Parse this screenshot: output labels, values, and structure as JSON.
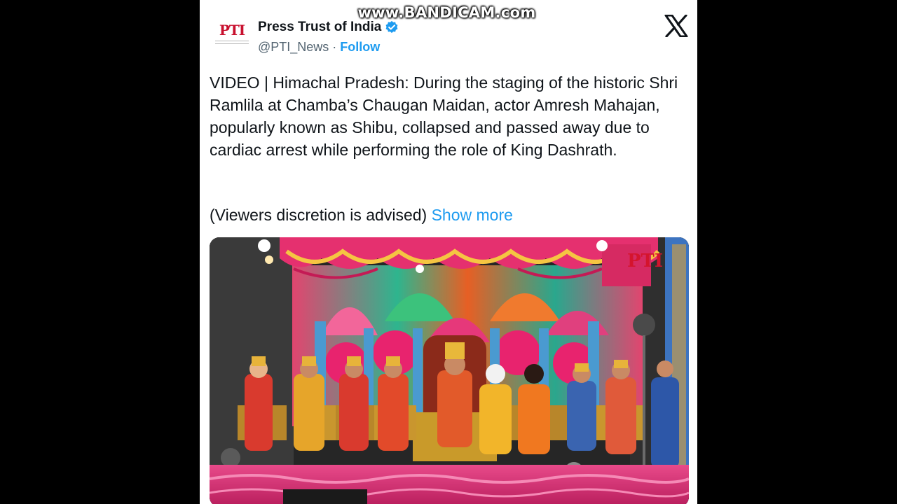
{
  "watermark": "www.BANDICAM.com",
  "tweet": {
    "author": {
      "display_name": "Press Trust of India",
      "handle": "@PTI_News",
      "follow_label": "Follow",
      "logo_text": "PTI",
      "verified": true
    },
    "text": "VIDEO | Himachal Pradesh: During the staging of the historic Shri Ramlila at Chamba’s Chaugan Maidan, actor Amresh Mahajan, popularly known as Shibu, collapsed and passed away due to cardiac arrest while performing the role of King Dashrath.",
    "advisory": "(Viewers discretion is advised)",
    "show_more_label": "Show more",
    "media_watermark": "PTI"
  },
  "icons": {
    "platform": "x-logo-icon",
    "verified": "verified-badge-icon"
  },
  "colors": {
    "background": "#000000",
    "card": "#ffffff",
    "accent": "#1d9bf0",
    "text": "#0f1419",
    "muted": "#536471",
    "pti_red": "#c8102e"
  }
}
